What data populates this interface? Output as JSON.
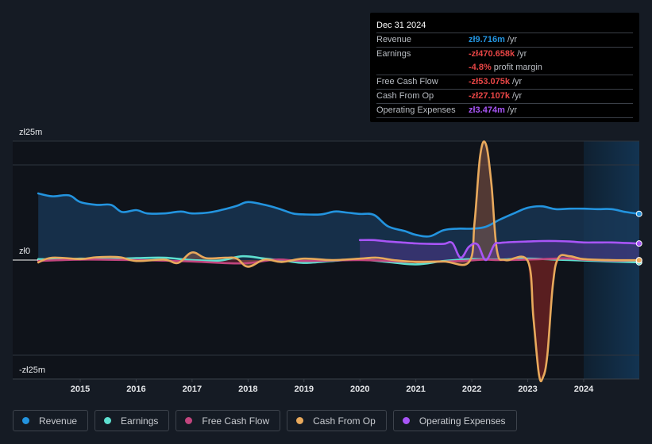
{
  "tooltip": {
    "date": "Dec 31 2024",
    "rows": [
      {
        "label": "Revenue",
        "value": "zł9.716m",
        "unit": "/yr",
        "color": "#2394df"
      },
      {
        "label": "Earnings",
        "value": "-zł470.658k",
        "unit": "/yr",
        "color": "#e64545"
      },
      {
        "label": "",
        "value": "-4.8%",
        "unit": "profit margin",
        "color": "#e64545"
      },
      {
        "label": "Free Cash Flow",
        "value": "-zł53.075k",
        "unit": "/yr",
        "color": "#e64545"
      },
      {
        "label": "Cash From Op",
        "value": "-zł27.107k",
        "unit": "/yr",
        "color": "#e64545"
      },
      {
        "label": "Operating Expenses",
        "value": "zł3.474m",
        "unit": "/yr",
        "color": "#a855f7"
      }
    ]
  },
  "legend": [
    {
      "label": "Revenue",
      "color": "#2394df"
    },
    {
      "label": "Earnings",
      "color": "#5ee0d0"
    },
    {
      "label": "Free Cash Flow",
      "color": "#c2457e"
    },
    {
      "label": "Cash From Op",
      "color": "#e8a95c"
    },
    {
      "label": "Operating Expenses",
      "color": "#a855f7"
    }
  ],
  "chart_data": {
    "type": "line",
    "title": "",
    "xlabel": "",
    "ylabel": "",
    "y_tick_labels": [
      "zł25m",
      "zł0",
      "-zł25m"
    ],
    "y_ticks": [
      25,
      0,
      -25
    ],
    "x_tick_labels": [
      "2015",
      "2016",
      "2017",
      "2018",
      "2019",
      "2020",
      "2021",
      "2022",
      "2023",
      "2024"
    ],
    "x_ticks": [
      2015,
      2016,
      2017,
      2018,
      2019,
      2020,
      2021,
      2022,
      2023,
      2024
    ],
    "xlim": [
      2014.25,
      2025.0
    ],
    "ylim": [
      -25,
      25
    ],
    "forecast_shade_start": 2024.0,
    "units": "PLN millions",
    "series": [
      {
        "name": "Revenue",
        "color": "#2394df",
        "fill": true,
        "x": [
          2014.25,
          2014.5,
          2014.8,
          2015.0,
          2015.3,
          2015.55,
          2015.75,
          2016.0,
          2016.2,
          2016.5,
          2016.8,
          2017.0,
          2017.3,
          2017.55,
          2017.8,
          2018.0,
          2018.3,
          2018.55,
          2018.8,
          2019.0,
          2019.3,
          2019.55,
          2019.75,
          2020.0,
          2020.25,
          2020.5,
          2020.8,
          2021.0,
          2021.25,
          2021.5,
          2021.75,
          2022.0,
          2022.25,
          2022.5,
          2022.75,
          2023.0,
          2023.25,
          2023.5,
          2023.75,
          2024.0,
          2024.25,
          2024.5,
          2024.75,
          2024.99
        ],
        "values": [
          14.0,
          13.4,
          13.6,
          12.2,
          11.6,
          11.6,
          10.1,
          10.5,
          9.8,
          9.8,
          10.2,
          9.8,
          10.0,
          10.6,
          11.4,
          12.2,
          11.6,
          10.8,
          9.8,
          9.6,
          9.6,
          10.2,
          10.0,
          9.7,
          9.5,
          7.1,
          6.1,
          5.3,
          5.0,
          6.3,
          6.6,
          6.6,
          7.0,
          8.5,
          9.8,
          11.0,
          11.3,
          10.7,
          10.8,
          10.8,
          10.7,
          10.7,
          10.1,
          9.716
        ]
      },
      {
        "name": "Earnings",
        "color": "#5ee0d0",
        "fill": false,
        "x": [
          2014.25,
          2014.6,
          2015.0,
          2015.5,
          2016.0,
          2016.5,
          2017.0,
          2017.5,
          2017.9,
          2018.3,
          2018.7,
          2019.0,
          2019.5,
          2020.0,
          2020.5,
          2021.0,
          2021.5,
          2022.0,
          2022.5,
          2023.0,
          2023.5,
          2024.0,
          2024.5,
          2024.99
        ],
        "values": [
          0.2,
          0.1,
          0.3,
          0.2,
          0.4,
          0.5,
          0.0,
          -0.1,
          0.8,
          0.3,
          -0.2,
          -0.6,
          -0.2,
          0.1,
          -0.4,
          -0.9,
          -0.2,
          0.2,
          0.1,
          0.3,
          0.1,
          -0.1,
          -0.3,
          -0.470658
        ]
      },
      {
        "name": "Free Cash Flow",
        "color": "#c2457e",
        "fill": true,
        "x": [
          2014.25,
          2015.0,
          2016.0,
          2017.0,
          2017.9,
          2018.5,
          2019.0,
          2020.0,
          2021.0,
          2021.8,
          2022.2,
          2022.5,
          2023.0,
          2023.5,
          2023.75,
          2024.0,
          2024.5,
          2024.99
        ],
        "values": [
          -0.2,
          0.1,
          0.0,
          -0.3,
          -0.7,
          0.1,
          -0.2,
          0.0,
          -0.4,
          -0.2,
          0.1,
          0.0,
          0.1,
          0.3,
          0.3,
          0.1,
          -0.1,
          -0.053075
        ]
      },
      {
        "name": "Cash From Op",
        "color": "#e8a95c",
        "fill": true,
        "x": [
          2014.25,
          2014.5,
          2015.0,
          2015.3,
          2015.7,
          2016.0,
          2016.5,
          2016.75,
          2017.0,
          2017.25,
          2017.6,
          2017.8,
          2018.0,
          2018.3,
          2018.6,
          2019.0,
          2019.5,
          2020.0,
          2020.3,
          2020.6,
          2021.0,
          2021.5,
          2021.95,
          2022.05,
          2022.15,
          2022.25,
          2022.35,
          2022.45,
          2022.6,
          2023.0,
          2023.1,
          2023.2,
          2023.27,
          2023.35,
          2023.45,
          2023.55,
          2023.75,
          2024.0,
          2024.5,
          2024.99
        ],
        "values": [
          -0.5,
          0.5,
          0.2,
          0.6,
          0.6,
          -0.2,
          0.1,
          -0.6,
          1.6,
          0.4,
          0.5,
          0.3,
          -1.4,
          0.1,
          -0.4,
          0.3,
          0.0,
          0.3,
          0.5,
          0.0,
          -0.4,
          -0.3,
          -0.4,
          8.0,
          22.0,
          24.4,
          16.0,
          2.0,
          0.0,
          -0.2,
          -12.0,
          -24.0,
          -24.7,
          -20.0,
          -5.0,
          0.5,
          0.8,
          0.2,
          0.0,
          -0.027107
        ]
      },
      {
        "name": "Operating Expenses",
        "color": "#a855f7",
        "fill": true,
        "x": [
          2020.0,
          2020.25,
          2020.5,
          2020.75,
          2021.0,
          2021.25,
          2021.5,
          2021.65,
          2021.8,
          2021.95,
          2022.1,
          2022.25,
          2022.4,
          2022.5,
          2022.75,
          2023.0,
          2023.25,
          2023.5,
          2023.75,
          2024.0,
          2024.25,
          2024.5,
          2024.75,
          2024.99
        ],
        "values": [
          4.2,
          4.2,
          3.9,
          3.7,
          3.5,
          3.4,
          3.4,
          3.6,
          0.5,
          2.8,
          3.3,
          0.0,
          3.2,
          3.6,
          3.8,
          3.9,
          4.0,
          4.0,
          3.9,
          3.7,
          3.7,
          3.7,
          3.6,
          3.474
        ]
      }
    ]
  }
}
